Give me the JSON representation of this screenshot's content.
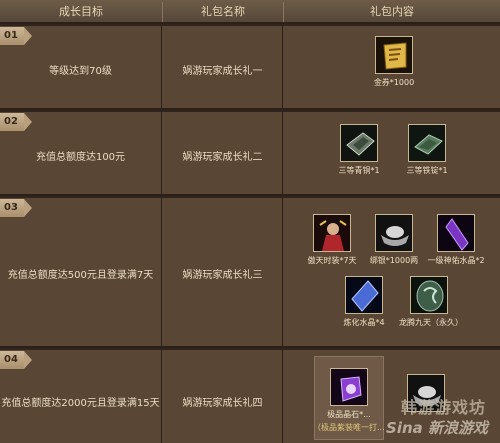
{
  "header": {
    "col1": "成长目标",
    "col2": "礼包名称",
    "col3": "礼包内容"
  },
  "rows": [
    {
      "num": "01",
      "goal": "等级达到70级",
      "pack": "娲游玩家成长礼一",
      "items": [
        {
          "name": "金券*1000",
          "icon": "gold-coupon-icon"
        }
      ]
    },
    {
      "num": "02",
      "goal": "充值总额度达100元",
      "pack": "娲游玩家成长礼二",
      "items": [
        {
          "name": "三等青铜*1",
          "icon": "bronze-ingot-icon"
        },
        {
          "name": "三等铁锭*1",
          "icon": "iron-ingot-icon"
        }
      ]
    },
    {
      "num": "03",
      "goal": "充值总额度达500元且登录满7天",
      "pack": "娲游玩家成长礼三",
      "items": [
        {
          "name": "傲天时装*7天",
          "icon": "costume-icon"
        },
        {
          "name": "绑银*1000两",
          "icon": "silver-ingot-icon"
        },
        {
          "name": "一级神佑水晶*2",
          "icon": "purple-crystal-icon"
        },
        {
          "name": "炼化水晶*4",
          "icon": "blue-crystal-icon"
        },
        {
          "name": "龙腾九天（永久）",
          "icon": "dragon-token-icon"
        }
      ]
    },
    {
      "num": "04",
      "goal": "充值总额度达2000元且登录满15天",
      "pack": "娲游玩家成长礼四",
      "items": [
        {
          "name": "极品晶石*...",
          "icon": "premium-crystal-icon"
        },
        {
          "name": "",
          "icon": "silver-ingot-icon"
        }
      ],
      "note": "（极品紫装唯一打..."
    }
  ],
  "watermark": {
    "line1": "韩游游戏坊",
    "line2": "Sina 新浪游戏"
  }
}
